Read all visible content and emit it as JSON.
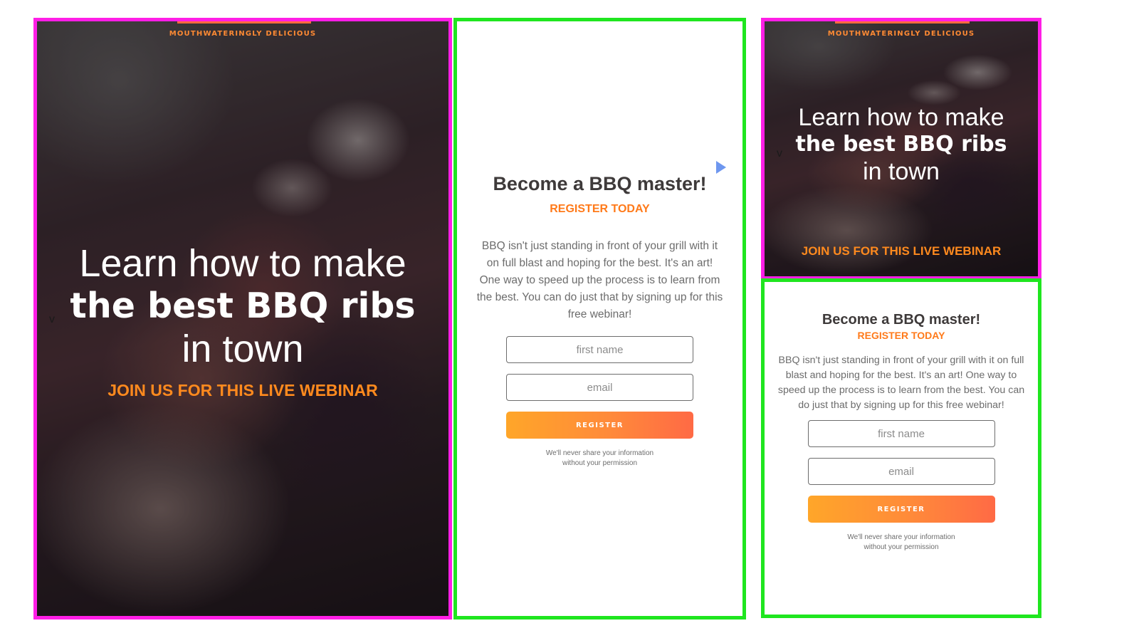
{
  "hero": {
    "eyebrow": "MOUTHWATERINGLY DELICIOUS",
    "line1": "Learn how to make",
    "line2": "the best BBQ ribs",
    "line3": "in town",
    "cta": "JOIN US FOR THIS LIVE WEBINAR",
    "scroll_mark": "v"
  },
  "form": {
    "title": "Become a BBQ master!",
    "subtitle": "REGISTER TODAY",
    "description": "BBQ isn't just standing in front of your grill with it on full blast and hoping for the best. It's an art! One way to speed up the process is to learn from the best. You can do just that by signing up for this free webinar!",
    "first_name_placeholder": "first name",
    "email_placeholder": "email",
    "register_label": "REGISTER",
    "privacy_line1": "We'll never share your information",
    "privacy_line2": "without your permission"
  },
  "colors": {
    "frame_magenta": "#ff1ee6",
    "frame_green": "#1fe61f",
    "accent_orange": "#ff8a1e",
    "button_gradient_start": "#ffa629",
    "button_gradient_end": "#ff6a45"
  }
}
